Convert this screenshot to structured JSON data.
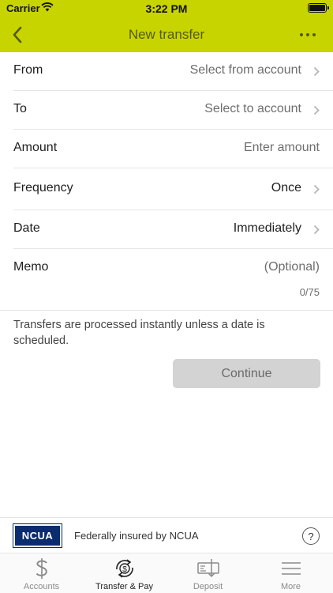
{
  "status_bar": {
    "carrier": "Carrier",
    "time": "3:22 PM"
  },
  "nav": {
    "title": "New transfer",
    "back_icon": "chevron-left-icon",
    "more_icon": "more-icon"
  },
  "form": {
    "from": {
      "label": "From",
      "value": "Select from account"
    },
    "to": {
      "label": "To",
      "value": "Select to account"
    },
    "amount": {
      "label": "Amount",
      "placeholder": "Enter amount"
    },
    "frequency": {
      "label": "Frequency",
      "value": "Once"
    },
    "date": {
      "label": "Date",
      "value": "Immediately"
    },
    "memo": {
      "label": "Memo",
      "placeholder": "(Optional)",
      "counter": "0/75"
    }
  },
  "info_text": "Transfers are processed instantly unless a date is scheduled.",
  "continue_label": "Continue",
  "footer": {
    "ncua_logo_text": "NCUA",
    "ncua_text": "Federally insured by NCUA",
    "help_label": "?"
  },
  "tabs": [
    {
      "label": "Accounts",
      "icon": "dollar-icon",
      "active": false
    },
    {
      "label": "Transfer & Pay",
      "icon": "transfer-icon",
      "active": true
    },
    {
      "label": "Deposit",
      "icon": "check-deposit-icon",
      "active": false
    },
    {
      "label": "More",
      "icon": "menu-icon",
      "active": false
    }
  ],
  "colors": {
    "header": "#c8d400",
    "header_text": "#545b00",
    "disabled_button": "#d3d3d3",
    "ncua_blue": "#0b2c6e"
  }
}
